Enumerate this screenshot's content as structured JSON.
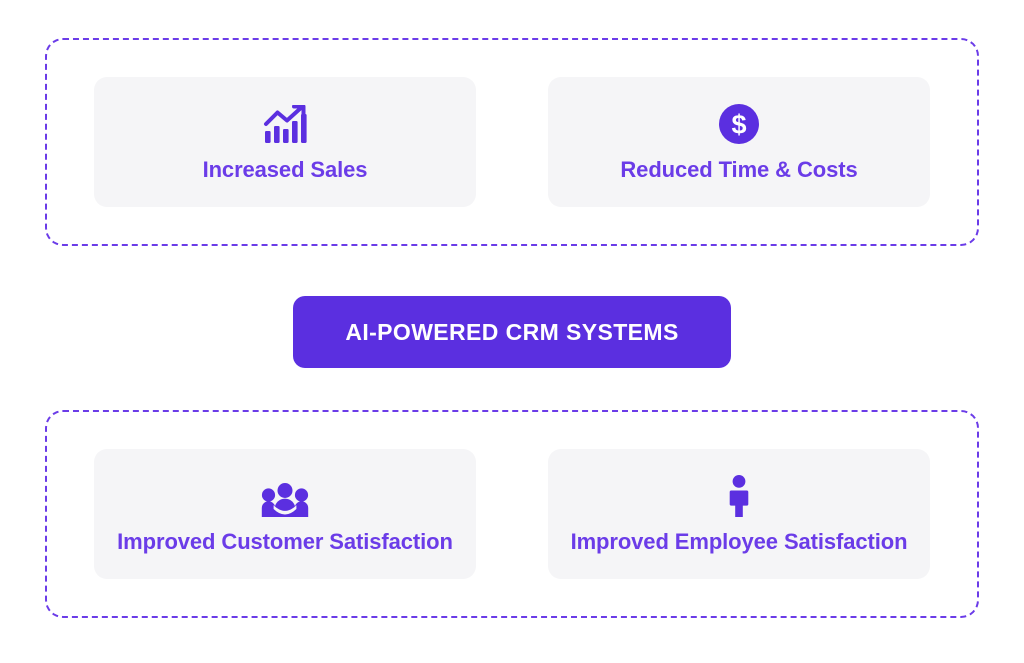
{
  "colors": {
    "accent": "#6b3ce8",
    "pill_background": "#5b2fe0",
    "card_background": "#f5f5f7",
    "dashed_border": "#6b3ce8",
    "pill_text": "#ffffff",
    "page_background": "#ffffff"
  },
  "center": {
    "label": "AI-POWERED CRM SYSTEMS"
  },
  "groups": [
    {
      "name": "top-benefits-group",
      "cards": [
        {
          "label": "Increased Sales",
          "icon": "bar-chart-trend-up-icon"
        },
        {
          "label": "Reduced Time & Costs",
          "icon": "dollar-circle-icon"
        }
      ]
    },
    {
      "name": "bottom-benefits-group",
      "cards": [
        {
          "label": "Improved Customer Satisfaction",
          "icon": "people-group-icon"
        },
        {
          "label": "Improved Employee Satisfaction",
          "icon": "person-icon"
        }
      ]
    }
  ]
}
